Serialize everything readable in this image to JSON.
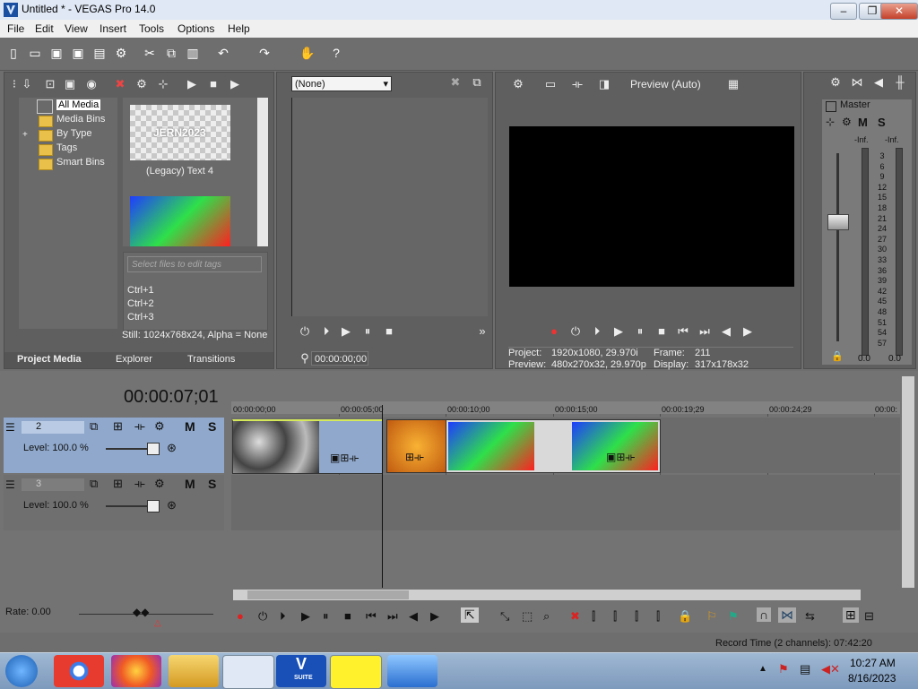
{
  "window": {
    "title": "Untitled * - VEGAS Pro 14.0",
    "min": "0",
    "max": "1",
    "close": "r"
  },
  "menu": [
    "File",
    "Edit",
    "View",
    "Insert",
    "Tools",
    "Options",
    "Help"
  ],
  "project_media": {
    "tree": [
      "All Media",
      "Media Bins",
      "By Type",
      "Tags",
      "Smart Bins"
    ],
    "expand_glyph": "+",
    "thumb1_text": "JERN2023",
    "thumb1_label": "(Legacy) Text 4",
    "tags_placeholder": "Select files to edit tags",
    "shortcuts": [
      "Ctrl+1",
      "Ctrl+2",
      "Ctrl+3"
    ],
    "still_info": "Still: 1024x768x24, Alpha = None",
    "tabs": [
      "Project Media",
      "Explorer",
      "Transitions"
    ]
  },
  "trimmer": {
    "select": "(None)",
    "timecode": "00:00:00;00"
  },
  "preview": {
    "mode": "Preview (Auto)",
    "project_label": "Project:",
    "project_value": "1920x1080, 29.970i",
    "preview_label": "Preview:",
    "preview_value": "480x270x32, 29.970p",
    "frame_label": "Frame:",
    "frame_value": "211",
    "display_label": "Display:",
    "display_value": "317x178x32"
  },
  "master": {
    "label": "Master",
    "m": "M",
    "s": "S",
    "inf_left": "-Inf.",
    "inf_right": "-Inf.",
    "scale": [
      "3",
      "6",
      "9",
      "12",
      "15",
      "18",
      "21",
      "24",
      "27",
      "30",
      "33",
      "36",
      "39",
      "42",
      "45",
      "48",
      "51",
      "54",
      "57"
    ],
    "val_left": "0.0",
    "val_right": "0.0"
  },
  "timeline": {
    "timecode": "00:00:07;01",
    "ruler": [
      "00:00:00;00",
      "00:00:05;00",
      "00:00:10;00",
      "00:00:15;00",
      "00:00:19;29",
      "00:00:24;29",
      "00:00:"
    ],
    "tracks": [
      {
        "num": "2",
        "level": "Level: 100.0 %",
        "m": "M",
        "s": "S"
      },
      {
        "num": "3",
        "level": "Level: 100.0 %",
        "m": "M",
        "s": "S"
      }
    ],
    "rate": "Rate: 0.00",
    "record_time": "Record Time (2 channels): 07:42:20"
  },
  "taskbar": {
    "time": "10:27 AM",
    "date": "8/16/2023",
    "vsuite": "SUITE"
  }
}
